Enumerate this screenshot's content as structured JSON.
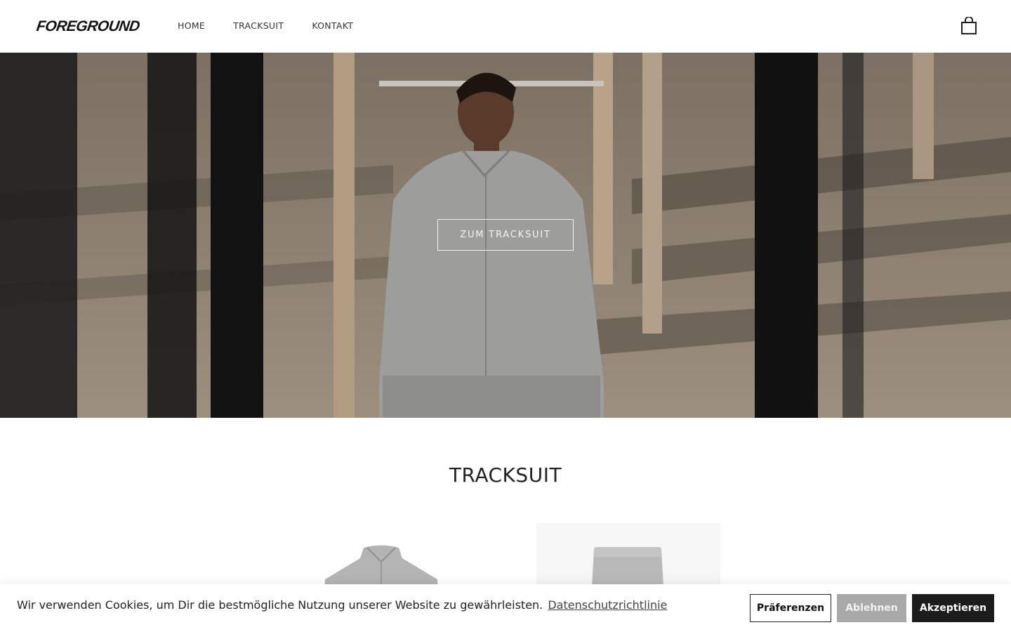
{
  "header": {
    "logo": "FOREGROUND",
    "nav": [
      {
        "label": "HOME"
      },
      {
        "label": "TRACKSUIT"
      },
      {
        "label": "KONTAKT"
      }
    ],
    "cart_icon": "shopping-bag-icon"
  },
  "hero": {
    "cta_label": "ZUM TRACKSUIT"
  },
  "section": {
    "title": "TRACKSUIT"
  },
  "cookie_banner": {
    "text": "Wir verwenden Cookies, um Dir die bestmögliche Nutzung unserer Website zu gewährleisten.",
    "link": "Datenschutzrichtlinie",
    "preferences": "Präferenzen",
    "decline": "Ablehnen",
    "accept": "Akzeptieren"
  },
  "colors": {
    "accent_dark": "#1c1c1c",
    "decline_gray": "#a9a9a9"
  }
}
